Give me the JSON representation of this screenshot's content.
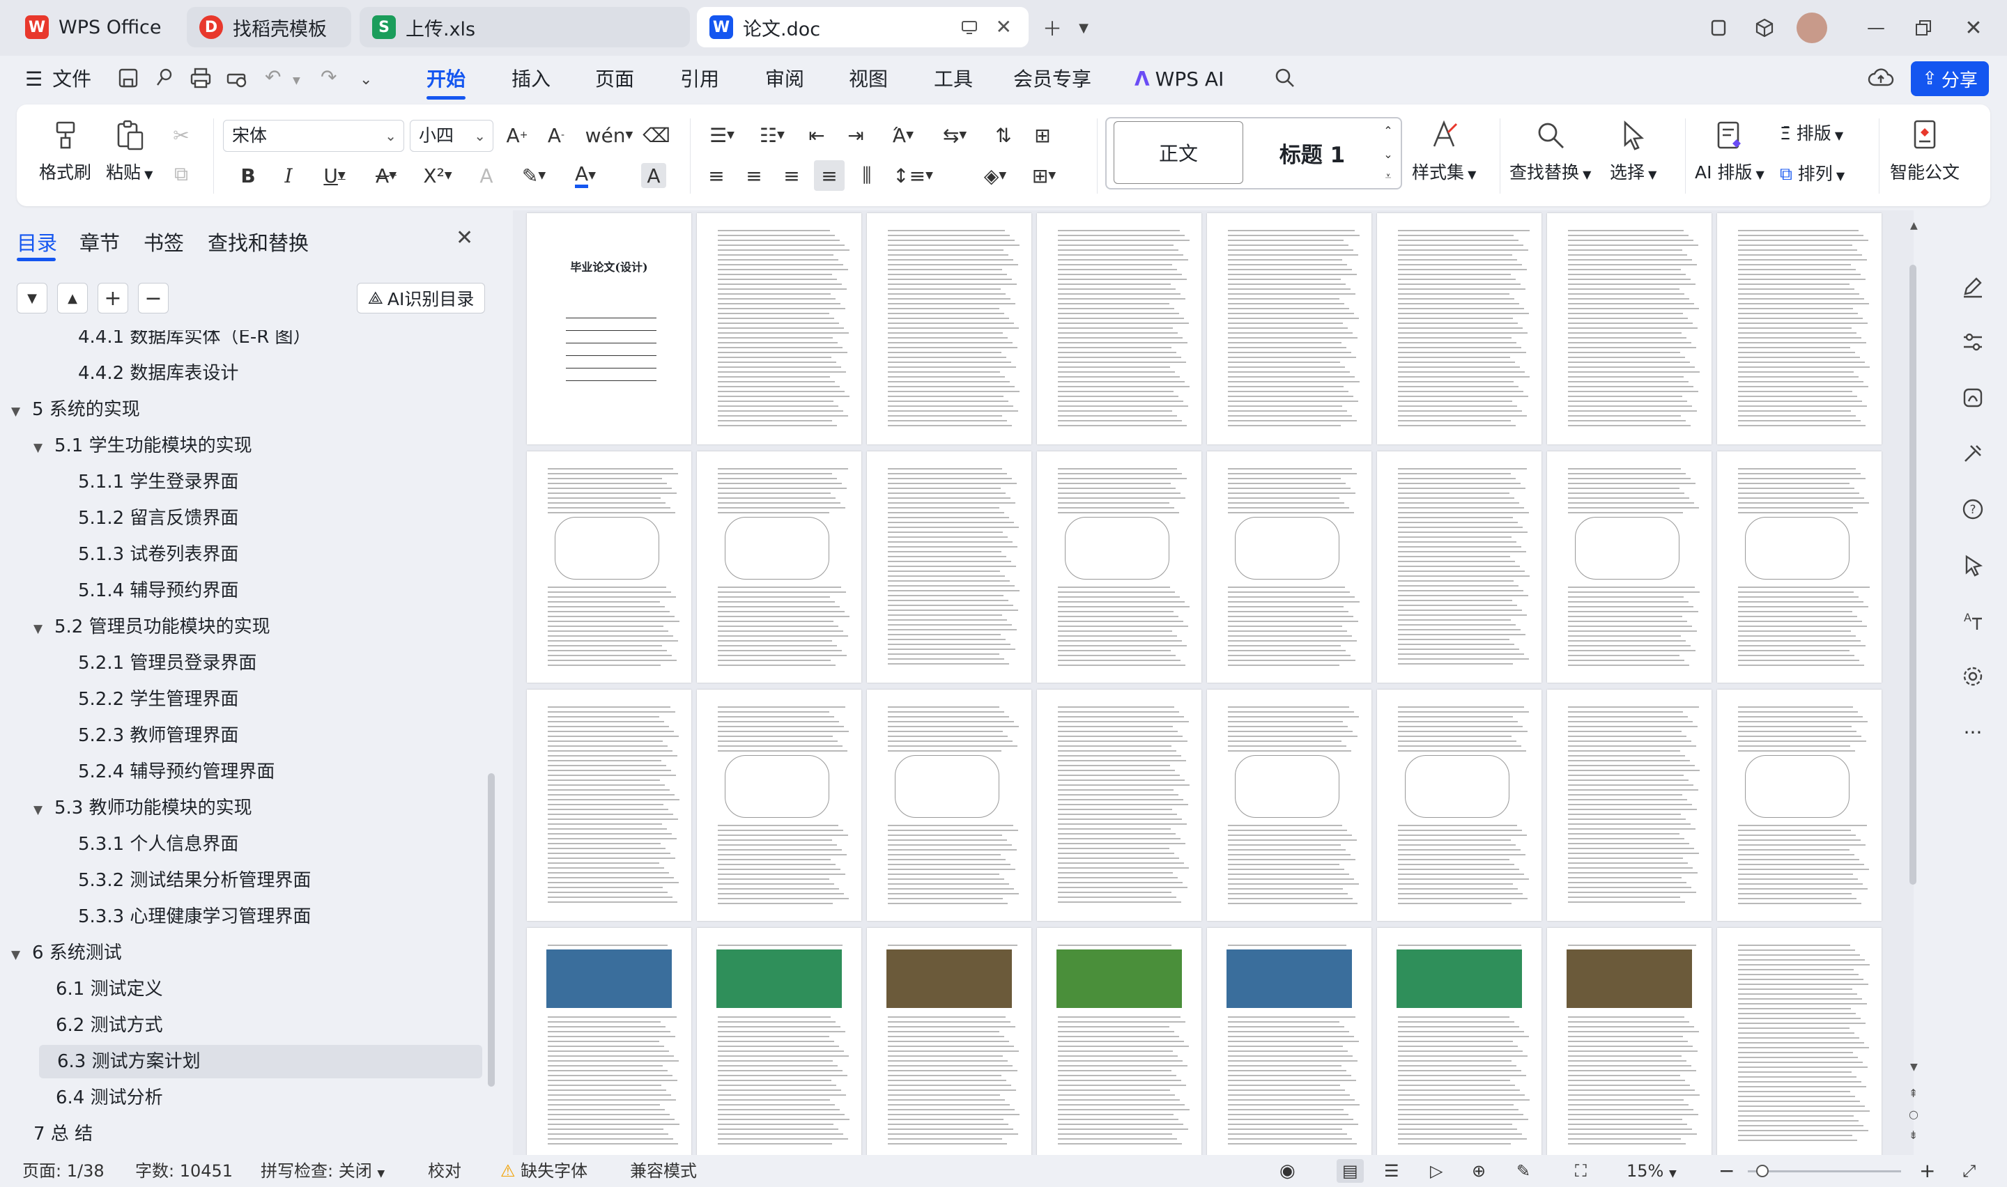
{
  "tabs": [
    {
      "label": "WPS Office",
      "icon": "wps-logo-icon",
      "color": "#e8382c"
    },
    {
      "label": "找稻壳模板",
      "icon": "docer-icon",
      "color": "#e8382c"
    },
    {
      "label": "上传.xls",
      "icon": "spreadsheet-icon",
      "color": "#1b9d5b"
    },
    {
      "label": "论文.doc",
      "icon": "writer-icon",
      "color": "#1456f0"
    }
  ],
  "menu": {
    "file": "文件",
    "items": [
      "开始",
      "插入",
      "页面",
      "引用",
      "审阅",
      "视图",
      "工具",
      "会员专享"
    ],
    "active": "开始",
    "wps_ai": "WPS AI",
    "share": "分享"
  },
  "ribbon": {
    "format_painter": "格式刷",
    "paste": "粘贴",
    "font_name": "宋体",
    "font_size": "小四",
    "style_normal": "正文",
    "style_heading": "标题 1",
    "style_set": "样式集",
    "find_replace": "查找替换",
    "select": "选择",
    "ai_layout": "AI 排版",
    "layout": "排版",
    "arrange": "排列",
    "smart_doc": "智能公文"
  },
  "panel": {
    "tabs": [
      "目录",
      "章节",
      "书签",
      "查找和替换"
    ],
    "active_tab": "目录",
    "ai_toc": "AI识别目录"
  },
  "toc": [
    {
      "label": "4.4.1  数据库实体（E-R 图）",
      "level": 3,
      "expand": ""
    },
    {
      "label": "4.4.2  数据库表设计",
      "level": 3,
      "expand": ""
    },
    {
      "label": "5  系统的实现",
      "level": 1,
      "expand": "▼"
    },
    {
      "label": "5.1 学生功能模块的实现",
      "level": 2,
      "expand": "▼"
    },
    {
      "label": "5.1.1  学生登录界面",
      "level": 3,
      "expand": ""
    },
    {
      "label": "5.1.2  留言反馈界面",
      "level": 3,
      "expand": ""
    },
    {
      "label": "5.1.3  试卷列表界面",
      "level": 3,
      "expand": ""
    },
    {
      "label": "5.1.4  辅导预约界面",
      "level": 3,
      "expand": ""
    },
    {
      "label": "5.2 管理员功能模块的实现",
      "level": 2,
      "expand": "▼"
    },
    {
      "label": "5.2.1  管理员登录界面",
      "level": 3,
      "expand": ""
    },
    {
      "label": "5.2.2  学生管理界面",
      "level": 3,
      "expand": ""
    },
    {
      "label": "5.2.3  教师管理界面",
      "level": 3,
      "expand": ""
    },
    {
      "label": "5.2.4  辅导预约管理界面",
      "level": 3,
      "expand": ""
    },
    {
      "label": "5.3 教师功能模块的实现",
      "level": 2,
      "expand": "▼"
    },
    {
      "label": "5.3.1  个人信息界面",
      "level": 3,
      "expand": ""
    },
    {
      "label": "5.3.2  测试结果分析管理界面",
      "level": 3,
      "expand": ""
    },
    {
      "label": "5.3.3  心理健康学习管理界面",
      "level": 3,
      "expand": ""
    },
    {
      "label": "6  系统测试",
      "level": 1,
      "expand": "▼"
    },
    {
      "label": "6.1 测试定义",
      "level": 2,
      "expand": ""
    },
    {
      "label": "6.2 测试方式",
      "level": 2,
      "expand": ""
    },
    {
      "label": "6.3 测试方案计划",
      "level": 2,
      "expand": "",
      "selected": true
    },
    {
      "label": "6.4 测试分析",
      "level": 2,
      "expand": ""
    },
    {
      "label": "7 总  结",
      "level": 1,
      "expand": ""
    }
  ],
  "cover": {
    "title": "毕业论文(设计)"
  },
  "status": {
    "page": "页面: 1/38",
    "words": "字数: 10451",
    "spell": "拼写检查: 关闭",
    "proof": "校对",
    "missing_font": "缺失字体",
    "compat": "兼容模式",
    "zoom": "15%"
  },
  "colors": {
    "accent": "#1456f0",
    "green": "#1b9d5b",
    "red": "#e8382c"
  }
}
